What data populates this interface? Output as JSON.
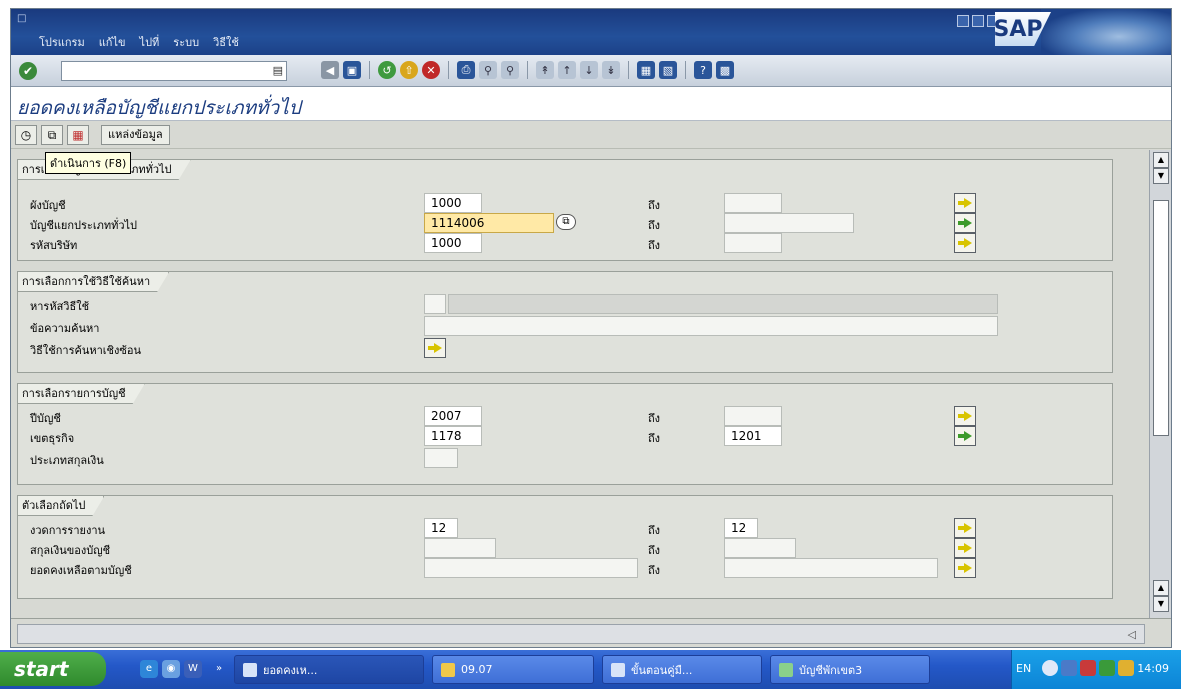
{
  "window": {
    "menu": [
      "โปรแกรม",
      "แก้ไข",
      "ไปที่",
      "ระบบ",
      "วิธีใช้"
    ],
    "logo": "SAP"
  },
  "std_toolbar": {
    "command_value": ""
  },
  "title": "ยอดคงเหลือบัญชีแยกประเภททั่วไป",
  "app_toolbar": {
    "data_source_label": "แหล่งข้อมูล",
    "tooltip": "ดำเนินการ  (F8)"
  },
  "groups": {
    "gl_selection": {
      "title": "การเลือกบัญชีแยกประเภททั่วไป",
      "rows": [
        {
          "label": "ผังบัญชี",
          "from": "1000",
          "to_label": "ถึง",
          "to": ""
        },
        {
          "label": "บัญชีแยกประเภททั่วไป",
          "from": "1114006",
          "to_label": "ถึง",
          "to": ""
        },
        {
          "label": "รหัสบริษัท",
          "from": "1000",
          "to_label": "ถึง",
          "to": ""
        }
      ]
    },
    "search_help": {
      "title": "การเลือกการใช้วิธีใช้ค้นหา",
      "rows": [
        {
          "label": "หารหัสวิธีใช้",
          "value": ""
        },
        {
          "label": "ข้อความค้นหา",
          "value": ""
        },
        {
          "label": "วิธีใช้การค้นหาเชิงซ้อน"
        }
      ]
    },
    "account_selection": {
      "title": "การเลือกรายการบัญชี",
      "rows": [
        {
          "label": "ปีบัญชี",
          "from": "2007",
          "to_label": "ถึง",
          "to": ""
        },
        {
          "label": "เขตธุรกิจ",
          "from": "1178",
          "to_label": "ถึง",
          "to": "1201"
        },
        {
          "label": "ประเภทสกุลเงิน",
          "from": ""
        }
      ]
    },
    "further_options": {
      "title": "ตัวเลือกถัดไป",
      "rows": [
        {
          "label": "งวดการรายงาน",
          "from": "12",
          "to_label": "ถึง",
          "to": "12"
        },
        {
          "label": "สกุลเงินของบัญชี",
          "from": "",
          "to_label": "ถึง",
          "to": ""
        },
        {
          "label": "ยอดคงเหลือตามบัญชี",
          "from": "",
          "to_label": "ถึง",
          "to": ""
        }
      ]
    }
  },
  "taskbar": {
    "start_label": "start",
    "tasks": [
      "ยอดคงเห...",
      "09.07",
      "ขั้นตอนคู่มื...",
      "บัญชีพักเขต3"
    ],
    "language": "EN",
    "clock": "14:09"
  },
  "colors": {
    "sap_blue": "#1c4188",
    "highlight_field": "#ffe9a6",
    "title_text": "#1c3d80",
    "taskbar": "#2458c8"
  }
}
